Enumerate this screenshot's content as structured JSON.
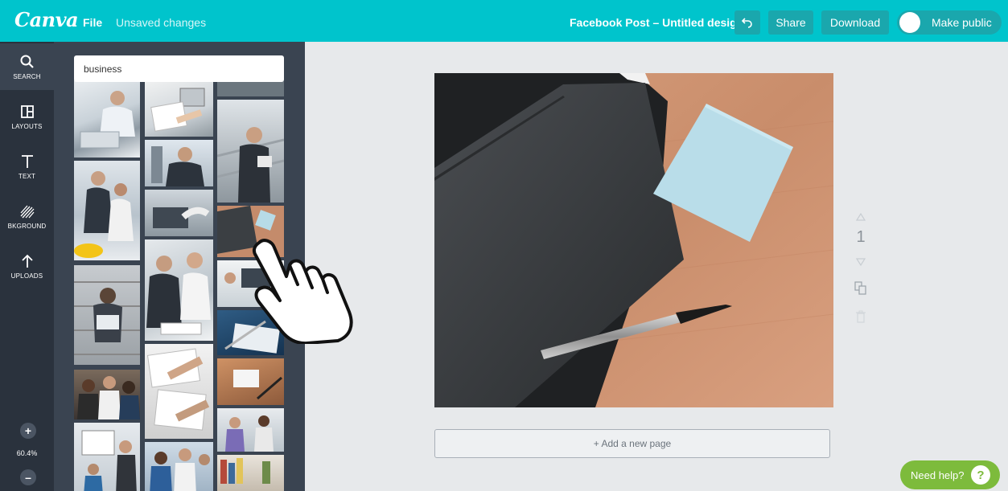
{
  "app": {
    "logo": "Canva",
    "menu_file": "File",
    "status": "Unsaved changes"
  },
  "header": {
    "doc_title": "Facebook Post – Untitled design",
    "share_label": "Share",
    "download_label": "Download",
    "make_public_label": "Make public"
  },
  "tools": [
    {
      "label": "SEARCH",
      "icon": "search-icon"
    },
    {
      "label": "LAYOUTS",
      "icon": "layouts-icon"
    },
    {
      "label": "TEXT",
      "icon": "text-icon"
    },
    {
      "label": "BKGROUND",
      "icon": "background-icon"
    },
    {
      "label": "UPLOADS",
      "icon": "upload-icon"
    }
  ],
  "zoom": {
    "level": "60.4%",
    "plus": "+",
    "minus": "–"
  },
  "search": {
    "value": "business"
  },
  "page_controls": {
    "page_number": "1"
  },
  "canvas": {
    "add_page_label": "+ Add a new page"
  },
  "help": {
    "label": "Need help?",
    "icon_text": "?"
  },
  "colors": {
    "brand": "#00c4cc",
    "toolbar_button": "#1aa7ad",
    "sidebar": "#2a323d",
    "panel": "#3a4451",
    "help": "#7dbb3c",
    "workspace": "#e7e9eb"
  }
}
